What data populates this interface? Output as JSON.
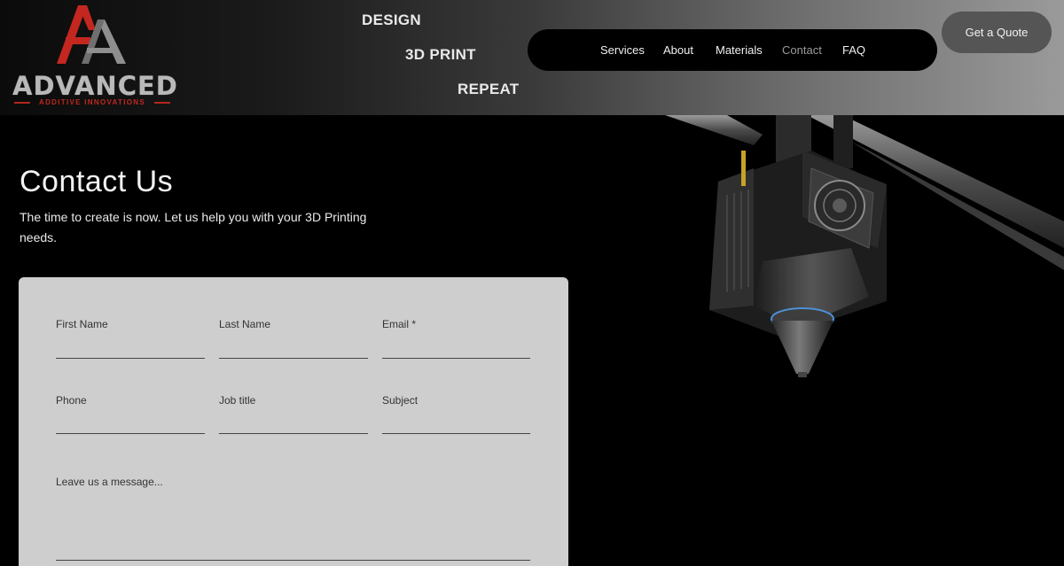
{
  "brand": {
    "name": "ADVANCED",
    "tagline": "ADDITIVE INNOVATIONS",
    "colors": {
      "red": "#b3261e",
      "gray": "#b9b9b9"
    }
  },
  "header": {
    "taglines": [
      "DESIGN",
      "3D PRINT",
      "REPEAT"
    ],
    "nav": [
      {
        "label": "Services",
        "active": false
      },
      {
        "label": "About",
        "active": false
      },
      {
        "label": "Materials",
        "active": false
      },
      {
        "label": "Contact",
        "active": true
      },
      {
        "label": "FAQ",
        "active": false
      }
    ],
    "cta_label": "Get a Quote"
  },
  "hero": {
    "title": "Contact Us",
    "subtitle": "The time to create is now. Let us help you with your 3D Printing needs."
  },
  "form": {
    "first_name": {
      "label": "First Name",
      "value": ""
    },
    "last_name": {
      "label": "Last Name",
      "value": ""
    },
    "email": {
      "label": "Email *",
      "value": ""
    },
    "phone": {
      "label": "Phone",
      "value": ""
    },
    "job_title": {
      "label": "Job title",
      "value": ""
    },
    "subject": {
      "label": "Subject",
      "value": ""
    },
    "message": {
      "placeholder": "Leave us a message...",
      "value": ""
    }
  },
  "images": {
    "hero_image": "3d-printer-nozzle-illustration"
  }
}
